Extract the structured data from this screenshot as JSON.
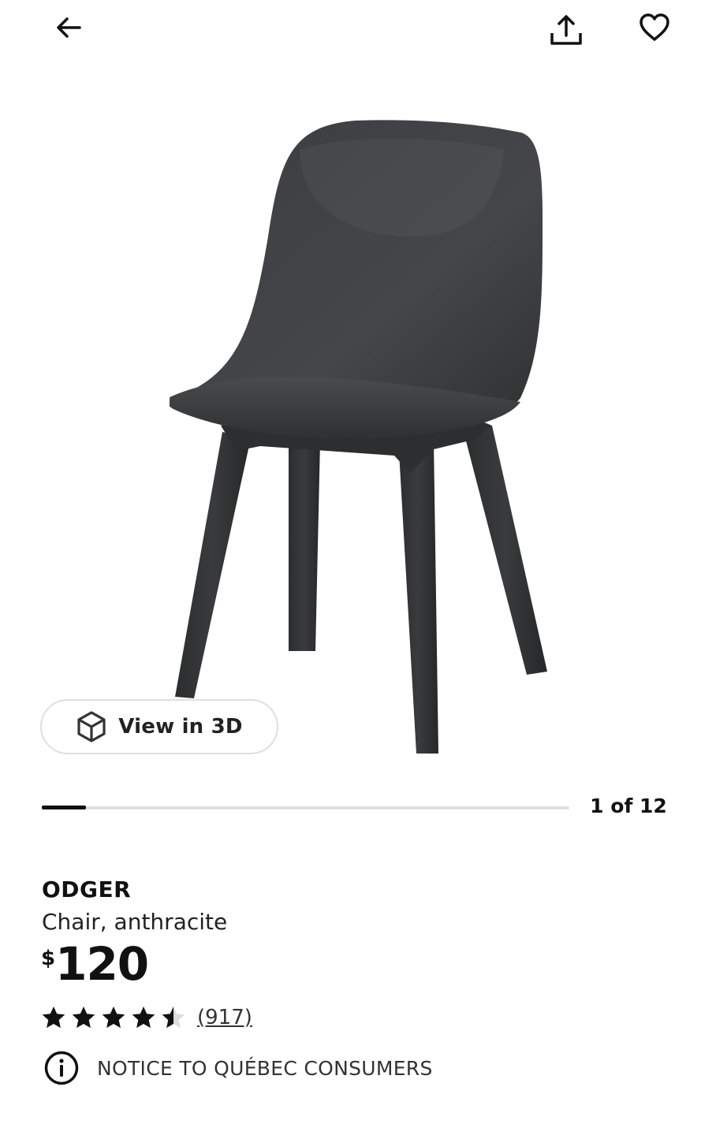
{
  "header": {
    "back_icon": "arrow-left-icon",
    "share_icon": "share-icon",
    "favorite_icon": "heart-outline-icon"
  },
  "gallery": {
    "image_subject": "black chair",
    "view3d_label": "View in 3D",
    "view3d_icon": "cube-icon",
    "position_text": "1 of 12",
    "current_index": 1,
    "total_images": 12
  },
  "product": {
    "name": "ODGER",
    "description": "Chair, anthracite",
    "price_currency": "$",
    "price_value": "120",
    "rating": 4.5,
    "rating_max": 5,
    "review_count": "(917)",
    "notice_icon": "info-circle-icon",
    "notice_text": "NOTICE TO QUÉBEC CONSUMERS"
  },
  "colors": {
    "text": "#111111",
    "chair": "#3a3b3d",
    "track": "#dfdfdf",
    "background": "#ffffff"
  }
}
